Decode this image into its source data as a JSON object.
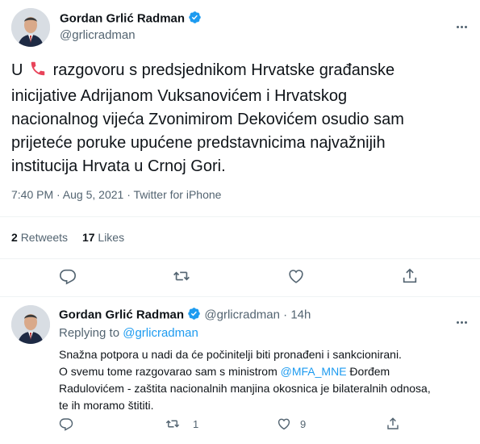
{
  "main_tweet": {
    "author_name": "Gordan Grlić Radman",
    "handle": "@grlicradman",
    "text_prefix": "U",
    "phone_emoji": "📞",
    "text_line1_rest": "razgovoru s predsjednikom Hrvatske građanske",
    "text_line2": "inicijative Adrijanom Vuksanovićem i Hrvatskog",
    "text_line3": "nacionalnog vijeća Zvonimirom Dekovićem osudio sam",
    "text_line4": "prijeteće poruke upućene predstavnicima najvažnijih",
    "text_line5": "institucija Hrvata u Crnoj Gori.",
    "meta": "7:40 PM · Aug 5, 2021 · Twitter for iPhone",
    "retweets_count": "2",
    "retweets_label": "Retweets",
    "likes_count": "17",
    "likes_label": "Likes"
  },
  "reply": {
    "author_name": "Gordan Grlić Radman",
    "handle": "@grlicradman",
    "dot": "·",
    "time": "14h",
    "replying_to_label": "Replying to",
    "replying_to_handle": "@grlicradman",
    "line1": "Snažna potpora u nadi da će počinitelji biti pronađeni i sankcionirani.",
    "line2_prefix": "O svemu tome razgovarao sam s ministrom",
    "line2_mention": "@MFA_MNE",
    "line2_suffix": "Đorđem",
    "line3": "Radulovićem - zaštita nacionalnih manjina okosnica je  bilateralnih odnosa,",
    "line4": "te ih moramo štititi.",
    "retweet_count": "1",
    "like_count": "9"
  },
  "colors": {
    "accent": "#1d9bf0",
    "text": "#0f1419",
    "muted": "#536471",
    "divider": "#eff3f4"
  },
  "icons": [
    "more-icon",
    "verified-icon",
    "phone-icon",
    "reply-icon",
    "retweet-icon",
    "like-icon",
    "share-icon"
  ]
}
